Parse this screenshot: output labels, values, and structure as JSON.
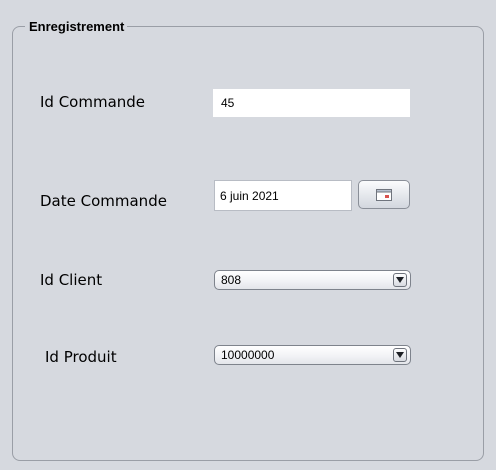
{
  "form": {
    "group_title": "Enregistrement",
    "fields": {
      "id_commande": {
        "label": "Id Commande",
        "value": "45"
      },
      "date_commande": {
        "label": "Date Commande",
        "value": "6 juin 2021",
        "calendar_icon": "calendar-icon"
      },
      "id_client": {
        "label": "Id Client",
        "selected": "808",
        "arrow_icon": "chevron-down-icon"
      },
      "id_produit": {
        "label": "Id Produit",
        "selected": "10000000",
        "arrow_icon": "chevron-down-icon"
      }
    }
  },
  "colors": {
    "panel_background": "#d6d9df",
    "border": "#9a9ea6",
    "field_background": "#ffffff"
  }
}
